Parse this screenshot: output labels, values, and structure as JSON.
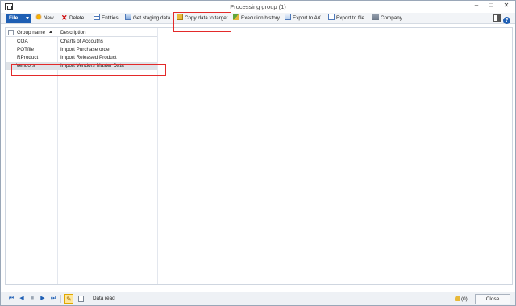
{
  "window": {
    "title": "Processing group (1)"
  },
  "toolbar": {
    "file_label": "File",
    "new_label": "New",
    "delete_label": "Delete",
    "entities_label": "Entities",
    "get_staging_label": "Get staging data",
    "copy_to_target_label": "Copy data to target",
    "execution_history_label": "Execution history",
    "export_ax_label": "Export to AX",
    "export_file_label": "Export to file",
    "company_label": "Company"
  },
  "grid": {
    "columns": [
      "Group name",
      "Description"
    ],
    "rows": [
      {
        "group": "COA",
        "description": "Charts of Accoutns"
      },
      {
        "group": "POTfile",
        "description": "Import Purchase order"
      },
      {
        "group": "RProduct",
        "description": "Import Released Product"
      },
      {
        "group": "Vendors",
        "description": "Import Vendors Master Data"
      }
    ],
    "selected_row": 3
  },
  "status": {
    "text": "Data read",
    "alert_count": "(0)",
    "close_label": "Close"
  },
  "colors": {
    "accent": "#1f5fb4",
    "highlight": "#e32a2a",
    "selection": "#dfe3e8"
  }
}
